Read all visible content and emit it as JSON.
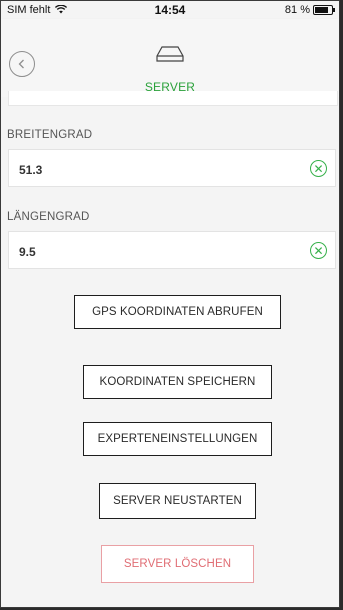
{
  "status_bar": {
    "carrier": "SIM fehlt",
    "time": "14:54",
    "battery": "81 %",
    "battery_level": 0.81
  },
  "header": {
    "title": "SERVER",
    "back_icon": "chevron-left-icon",
    "server_icon": "server-icon",
    "accent_color": "#2aa13a"
  },
  "fields": [
    {
      "label": "BREITENGRAD",
      "value": "51.3"
    },
    {
      "label": "LÄNGENGRAD",
      "value": "9.5"
    }
  ],
  "buttons": {
    "gps": "GPS KOORDINATEN ABRUFEN",
    "save": "KOORDINATEN SPEICHERN",
    "expert": "EXPERTENEINSTELLUNGEN",
    "restart": "SERVER NEUSTARTEN",
    "delete": "SERVER LÖSCHEN"
  },
  "colors": {
    "valid_green": "#36b04a",
    "danger_red": "#e06d74"
  }
}
